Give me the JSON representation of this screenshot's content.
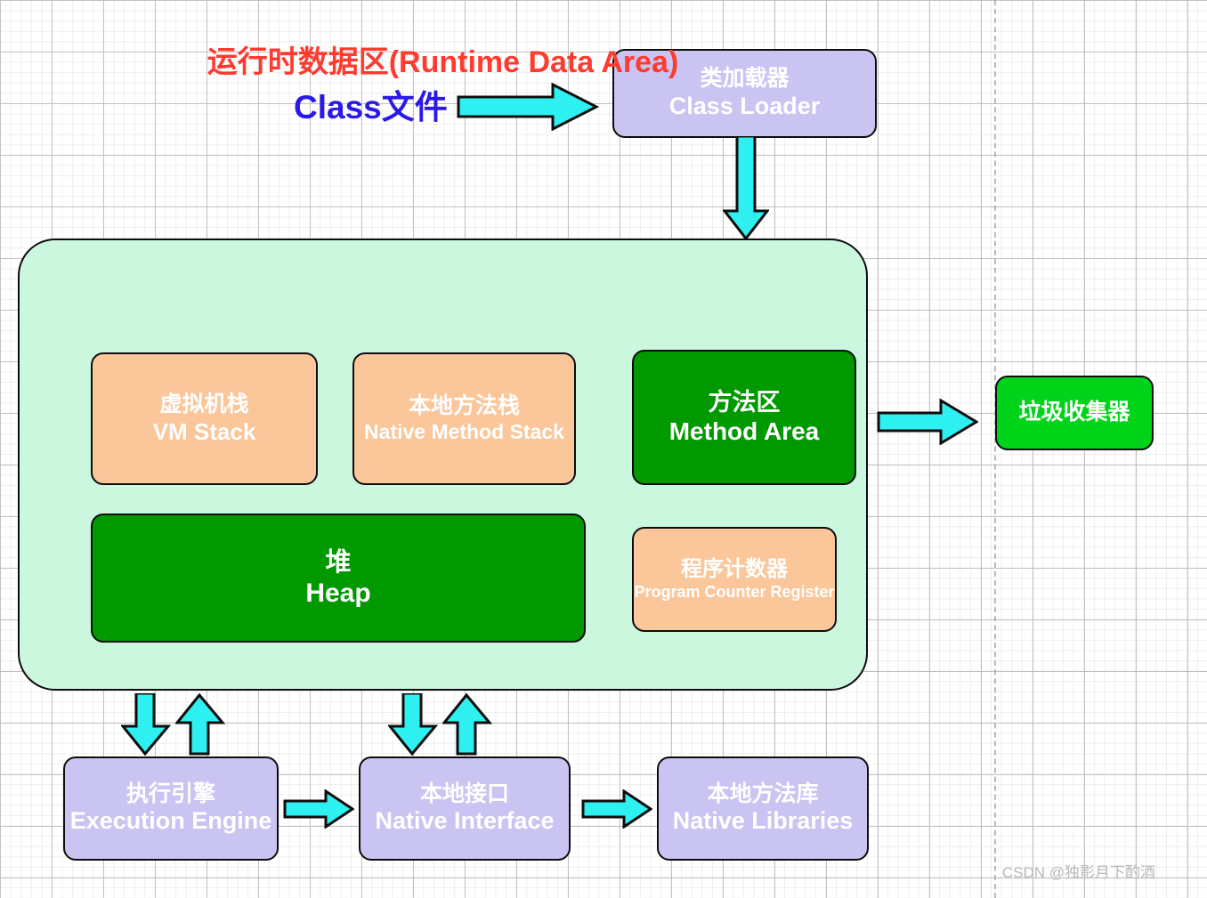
{
  "diagram": {
    "title_label": "Class文件",
    "runtime_area_title": "运行时数据区(Runtime Data Area)",
    "watermark": "CSDN @独影月下酌酒"
  },
  "nodes": {
    "class_loader": {
      "cn": "类加载器",
      "en": "Class Loader"
    },
    "vm_stack": {
      "cn": "虚拟机栈",
      "en": "VM Stack"
    },
    "native_method_stack": {
      "cn": "本地方法栈",
      "en": "Native Method Stack"
    },
    "method_area": {
      "cn": "方法区",
      "en": "Method Area"
    },
    "heap": {
      "cn": "堆",
      "en": "Heap"
    },
    "pc_register": {
      "cn": "程序计数器",
      "en": "Program Counter Register"
    },
    "garbage_collector": {
      "cn": "垃圾收集器",
      "en": ""
    },
    "execution_engine": {
      "cn": "执行引擎",
      "en": "Execution Engine"
    },
    "native_interface": {
      "cn": "本地接口",
      "en": "Native Interface"
    },
    "native_libraries": {
      "cn": "本地方法库",
      "en": "Native Libraries"
    }
  },
  "colors": {
    "lavender": "#c9c4f2",
    "peach": "#fac69a",
    "dark_green": "#009900",
    "bright_green": "#00d41a",
    "container_green": "#ccf7df",
    "arrow_cyan": "#2ff0f0",
    "title_red": "#ff3b30",
    "class_file_blue": "#2a19e8",
    "outline": "#0d0d0d",
    "watermark_gray": "#b8b8b8"
  },
  "icons": {
    "arrow_class_to_loader": "arrow-right-icon",
    "arrow_loader_to_runtime": "arrow-down-icon",
    "arrow_method_to_gc": "arrow-right-icon",
    "arrow_runtime_to_engine": "arrow-down-icon",
    "arrow_engine_to_runtime": "arrow-up-icon",
    "arrow_runtime_to_native": "arrow-down-icon",
    "arrow_native_to_runtime": "arrow-up-icon",
    "arrow_engine_to_interface": "arrow-right-icon",
    "arrow_interface_to_libraries": "arrow-right-icon"
  }
}
